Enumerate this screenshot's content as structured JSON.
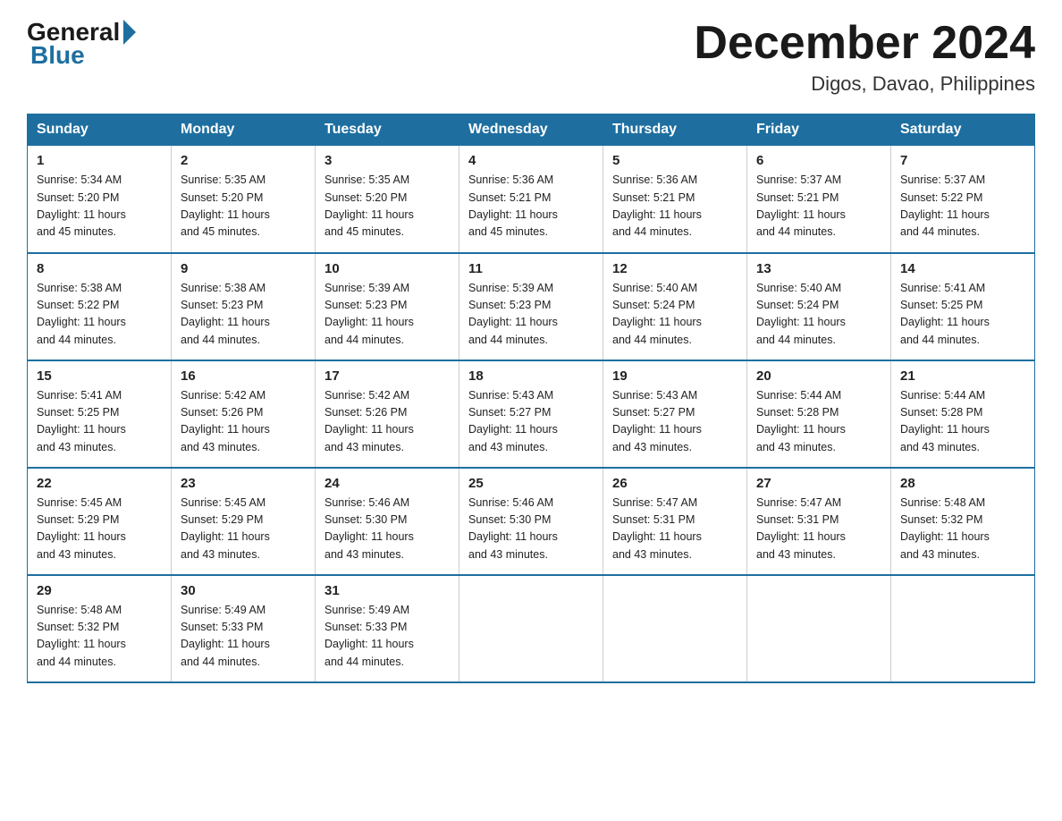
{
  "header": {
    "logo_general": "General",
    "logo_blue": "Blue",
    "month": "December 2024",
    "location": "Digos, Davao, Philippines"
  },
  "days_of_week": [
    "Sunday",
    "Monday",
    "Tuesday",
    "Wednesday",
    "Thursday",
    "Friday",
    "Saturday"
  ],
  "weeks": [
    [
      {
        "day": "1",
        "sunrise": "5:34 AM",
        "sunset": "5:20 PM",
        "daylight": "11 hours and 45 minutes."
      },
      {
        "day": "2",
        "sunrise": "5:35 AM",
        "sunset": "5:20 PM",
        "daylight": "11 hours and 45 minutes."
      },
      {
        "day": "3",
        "sunrise": "5:35 AM",
        "sunset": "5:20 PM",
        "daylight": "11 hours and 45 minutes."
      },
      {
        "day": "4",
        "sunrise": "5:36 AM",
        "sunset": "5:21 PM",
        "daylight": "11 hours and 45 minutes."
      },
      {
        "day": "5",
        "sunrise": "5:36 AM",
        "sunset": "5:21 PM",
        "daylight": "11 hours and 44 minutes."
      },
      {
        "day": "6",
        "sunrise": "5:37 AM",
        "sunset": "5:21 PM",
        "daylight": "11 hours and 44 minutes."
      },
      {
        "day": "7",
        "sunrise": "5:37 AM",
        "sunset": "5:22 PM",
        "daylight": "11 hours and 44 minutes."
      }
    ],
    [
      {
        "day": "8",
        "sunrise": "5:38 AM",
        "sunset": "5:22 PM",
        "daylight": "11 hours and 44 minutes."
      },
      {
        "day": "9",
        "sunrise": "5:38 AM",
        "sunset": "5:23 PM",
        "daylight": "11 hours and 44 minutes."
      },
      {
        "day": "10",
        "sunrise": "5:39 AM",
        "sunset": "5:23 PM",
        "daylight": "11 hours and 44 minutes."
      },
      {
        "day": "11",
        "sunrise": "5:39 AM",
        "sunset": "5:23 PM",
        "daylight": "11 hours and 44 minutes."
      },
      {
        "day": "12",
        "sunrise": "5:40 AM",
        "sunset": "5:24 PM",
        "daylight": "11 hours and 44 minutes."
      },
      {
        "day": "13",
        "sunrise": "5:40 AM",
        "sunset": "5:24 PM",
        "daylight": "11 hours and 44 minutes."
      },
      {
        "day": "14",
        "sunrise": "5:41 AM",
        "sunset": "5:25 PM",
        "daylight": "11 hours and 44 minutes."
      }
    ],
    [
      {
        "day": "15",
        "sunrise": "5:41 AM",
        "sunset": "5:25 PM",
        "daylight": "11 hours and 43 minutes."
      },
      {
        "day": "16",
        "sunrise": "5:42 AM",
        "sunset": "5:26 PM",
        "daylight": "11 hours and 43 minutes."
      },
      {
        "day": "17",
        "sunrise": "5:42 AM",
        "sunset": "5:26 PM",
        "daylight": "11 hours and 43 minutes."
      },
      {
        "day": "18",
        "sunrise": "5:43 AM",
        "sunset": "5:27 PM",
        "daylight": "11 hours and 43 minutes."
      },
      {
        "day": "19",
        "sunrise": "5:43 AM",
        "sunset": "5:27 PM",
        "daylight": "11 hours and 43 minutes."
      },
      {
        "day": "20",
        "sunrise": "5:44 AM",
        "sunset": "5:28 PM",
        "daylight": "11 hours and 43 minutes."
      },
      {
        "day": "21",
        "sunrise": "5:44 AM",
        "sunset": "5:28 PM",
        "daylight": "11 hours and 43 minutes."
      }
    ],
    [
      {
        "day": "22",
        "sunrise": "5:45 AM",
        "sunset": "5:29 PM",
        "daylight": "11 hours and 43 minutes."
      },
      {
        "day": "23",
        "sunrise": "5:45 AM",
        "sunset": "5:29 PM",
        "daylight": "11 hours and 43 minutes."
      },
      {
        "day": "24",
        "sunrise": "5:46 AM",
        "sunset": "5:30 PM",
        "daylight": "11 hours and 43 minutes."
      },
      {
        "day": "25",
        "sunrise": "5:46 AM",
        "sunset": "5:30 PM",
        "daylight": "11 hours and 43 minutes."
      },
      {
        "day": "26",
        "sunrise": "5:47 AM",
        "sunset": "5:31 PM",
        "daylight": "11 hours and 43 minutes."
      },
      {
        "day": "27",
        "sunrise": "5:47 AM",
        "sunset": "5:31 PM",
        "daylight": "11 hours and 43 minutes."
      },
      {
        "day": "28",
        "sunrise": "5:48 AM",
        "sunset": "5:32 PM",
        "daylight": "11 hours and 43 minutes."
      }
    ],
    [
      {
        "day": "29",
        "sunrise": "5:48 AM",
        "sunset": "5:32 PM",
        "daylight": "11 hours and 44 minutes."
      },
      {
        "day": "30",
        "sunrise": "5:49 AM",
        "sunset": "5:33 PM",
        "daylight": "11 hours and 44 minutes."
      },
      {
        "day": "31",
        "sunrise": "5:49 AM",
        "sunset": "5:33 PM",
        "daylight": "11 hours and 44 minutes."
      },
      null,
      null,
      null,
      null
    ]
  ],
  "labels": {
    "sunrise": "Sunrise:",
    "sunset": "Sunset:",
    "daylight": "Daylight:"
  }
}
